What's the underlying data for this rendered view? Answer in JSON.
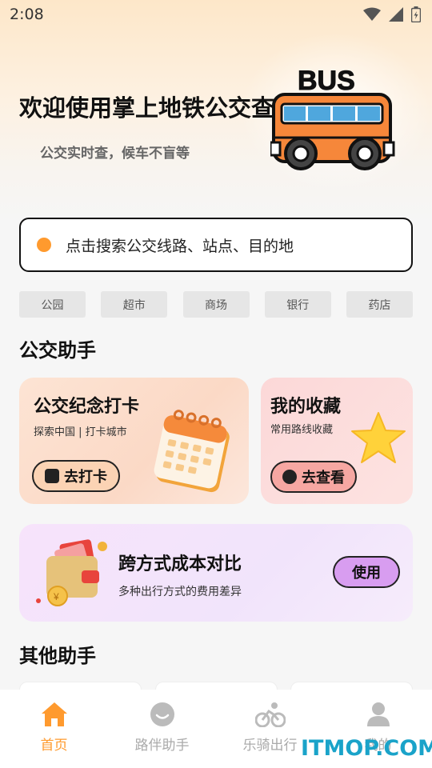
{
  "status_bar": {
    "time": "2:08"
  },
  "hero": {
    "title": "欢迎使用掌上地铁公交查",
    "subtitle": "公交实时查，候车不盲等",
    "bus_label": "BUS"
  },
  "search": {
    "placeholder": "点击搜索公交线路、站点、目的地"
  },
  "chips": [
    "公园",
    "超市",
    "商场",
    "银行",
    "药店"
  ],
  "section_bus_helper": "公交助手",
  "cards": {
    "checkin": {
      "title": "公交纪念打卡",
      "subtitle": "探索中国 | 打卡城市",
      "button": "去打卡"
    },
    "favorites": {
      "title": "我的收藏",
      "subtitle": "常用路线收藏",
      "button": "去查看"
    },
    "compare": {
      "title": "跨方式成本对比",
      "subtitle": "多种出行方式的费用差异",
      "button": "使用"
    }
  },
  "section_other_helper": "其他助手",
  "bottom_nav": [
    {
      "label": "首页",
      "icon": "home-icon",
      "active": true
    },
    {
      "label": "路伴助手",
      "icon": "chat-icon",
      "active": false
    },
    {
      "label": "乐骑出行",
      "icon": "bike-icon",
      "active": false
    },
    {
      "label": "我的",
      "icon": "user-icon",
      "active": false
    }
  ],
  "watermark": "ITMOP.COM",
  "colors": {
    "accent": "#ff9a2e",
    "bus_body": "#f6873a",
    "bus_window": "#4fa7dd"
  }
}
